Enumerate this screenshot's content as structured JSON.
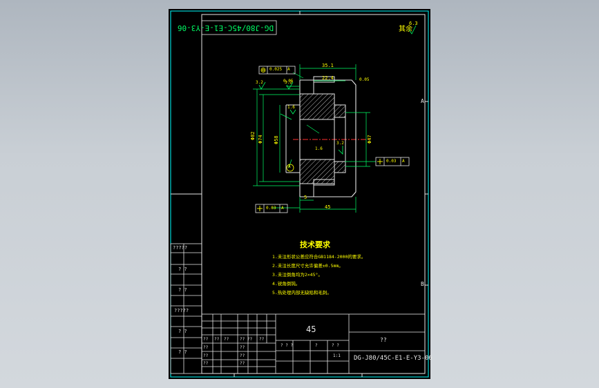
{
  "drawing": {
    "stamp_mirrored": "DG-J80/45C-E1-E-Y3-06",
    "roughness_rest": "其余",
    "roughness_rest_value": "6.3",
    "material": "45",
    "drawing_number": "DG-J80/45C-E1-E-Y3-06",
    "part_name": "??",
    "scale": "1:1",
    "sheet_flag": "??",
    "zone_a": "A",
    "zone_b": "B"
  },
  "dimensions": {
    "d_outer_top": "35.1",
    "d_inner_top": "22.4",
    "tol_a": "0.05",
    "tol_b": "0.05",
    "perp_bottom": "0.03",
    "perp_right": "0.03",
    "conc": "0.025",
    "phi_left_1": "Φ82",
    "phi_left_2": "Φ74",
    "phi_left_3": "Φ58",
    "phi_right": "Φ47",
    "h_small": "5",
    "len_45": "45",
    "r_small": "1.6",
    "datum": "A",
    "rough_left": "3.2",
    "rough_mid": "3.2",
    "rough_right": "3.2",
    "rough_center": "1.6"
  },
  "notes": {
    "title": "技术要求",
    "items": [
      "1.未注形状公差应符合GB1184-2000的要求。",
      "2.未注长度尺寸允许偏差±0.5mm。",
      "3.未注倒角均为2×45°。",
      "4.锐角倒钝。",
      "5.热处理内部无缺陷和毛刺。"
    ]
  },
  "left_strip": {
    "labels": [
      "?????",
      "? ?",
      "? ?",
      "?????",
      "? ?",
      "? ?"
    ]
  },
  "title_block": {
    "row_labels_a": [
      "?? ",
      "??",
      "??",
      "?? ??",
      "?? "
    ],
    "row_labels_b": [
      "??",
      "??",
      "??",
      "??",
      "??",
      "??"
    ],
    "mid_labels": [
      "? ? ?",
      "?",
      "? ?",
      "1:1"
    ]
  }
}
